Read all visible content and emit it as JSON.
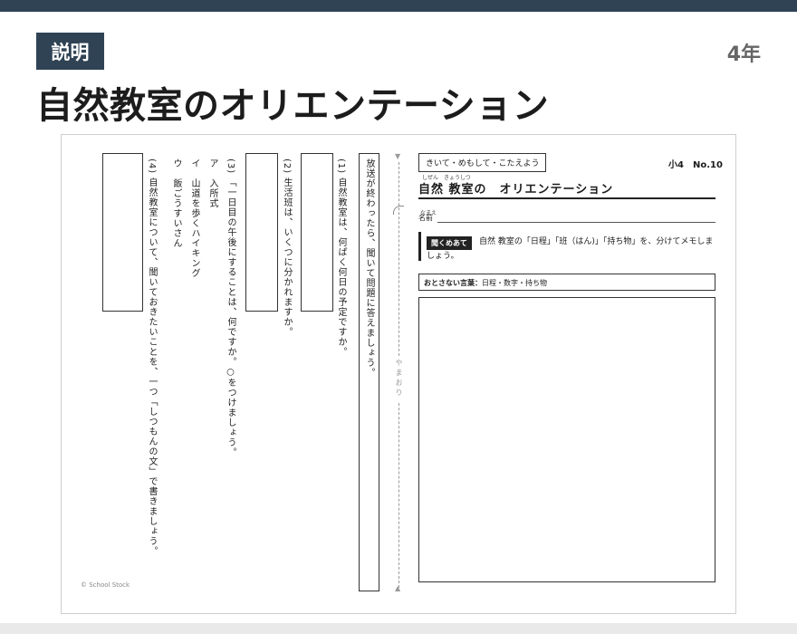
{
  "header": {
    "badge": "説明",
    "grade": "4年",
    "title": "自然教室のオリエンテーション"
  },
  "worksheet": {
    "copyright": "© School Stock",
    "fold_label": "やまおり",
    "instruction_column": "放送が終わったら、聞いて問題に答えましょう。",
    "q1_text": "(1) 自然教室は、何ぱく何日の予定ですか。",
    "q2_text": "(2) 生活班は、いくつに分かれますか。",
    "q3_text": "(3) 「一日目の午後にすることは、何ですか。○をつけましょう。",
    "q3_options": [
      "ア　入所式",
      "イ　山道を歩くハイキング",
      "ウ　飯ごうすいさん"
    ],
    "q4_text": "(4) 自然教室について、聞いておきたいことを、一つ「しつもんの文」で書きましょう。",
    "right": {
      "kikite": "きいて・めもして・こたえよう",
      "number": "小4　No.10",
      "title_furigana": "しぜん　きょうしつ",
      "title": "自然 教室の　オリエンテーション",
      "name_furigana": "なまえ",
      "name_label": "名前",
      "instruction_tag": "聞くめあて",
      "instruction_text": "自然 教室の「日程」「班（はん)」「持ち物」を、分けてメモしましょう。",
      "keywords_label": "おとさない言葉：",
      "keywords": "日程・数字・持ち物"
    }
  }
}
